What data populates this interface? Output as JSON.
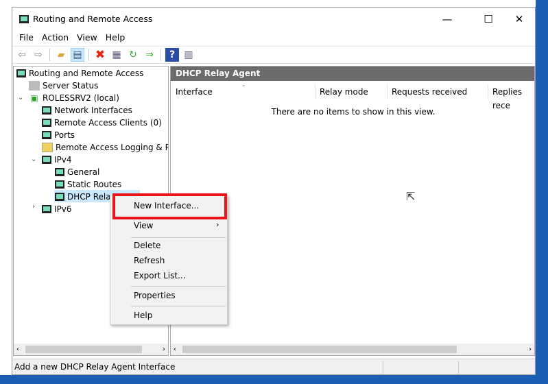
{
  "window": {
    "title": "Routing and Remote Access",
    "minimize": "—",
    "maximize": "☐",
    "close": "✕"
  },
  "menu": [
    "File",
    "Action",
    "View",
    "Help"
  ],
  "toolbar": [
    "back-icon",
    "forward-icon",
    "up-folder-icon",
    "show-hide-tree-icon",
    "delete-icon",
    "properties-icon",
    "refresh-icon",
    "export-list-icon",
    "help-icon",
    "show-hide-action-pane-icon"
  ],
  "tree": [
    {
      "label": "Routing and Remote Access"
    },
    {
      "label": "Server Status"
    },
    {
      "label": "ROLESSRV2 (local)"
    },
    {
      "label": "Network Interfaces"
    },
    {
      "label": "Remote Access Clients (0)"
    },
    {
      "label": "Ports"
    },
    {
      "label": "Remote Access Logging & Pol"
    },
    {
      "label": "IPv4"
    },
    {
      "label": "General"
    },
    {
      "label": "Static Routes"
    },
    {
      "label": "DHCP Relay Agent"
    },
    {
      "label": "IPv6"
    }
  ],
  "pane": {
    "title": "DHCP Relay Agent",
    "columns": [
      "Interface",
      "Relay mode",
      "Requests received",
      "Replies rece"
    ],
    "empty": "There are no items to show in this view."
  },
  "context_menu": {
    "items": [
      "New Interface...",
      "View",
      "Delete",
      "Refresh",
      "Export List...",
      "Properties",
      "Help"
    ]
  },
  "status": "Add a new DHCP Relay Agent Interface",
  "colors": {
    "highlight": "#e8141a",
    "header": "#6b6b6b",
    "selection": "#cce8ff"
  }
}
